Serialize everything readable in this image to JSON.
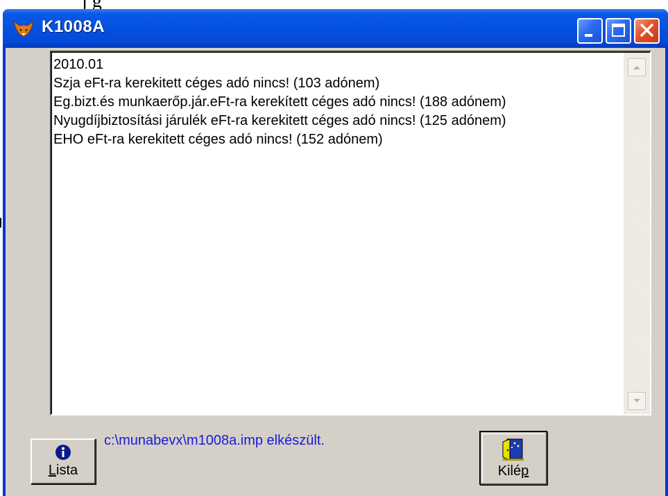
{
  "background": {
    "partial_text": "j g"
  },
  "window": {
    "title": "K1008A",
    "controls": {
      "minimize": "minimize-icon",
      "maximize": "maximize-icon",
      "close": "close-icon"
    }
  },
  "list": {
    "lines": [
      "2010.01",
      "Szja eFt-ra kerekitett céges adó nincs! (103 adónem)",
      "Eg.bizt.és munkaerőp.jár.eFt-ra kerekített céges adó nincs! (188 adónem)",
      "Nyugdíjbiztosítási járulék eFt-ra kerekitett céges adó nincs! (125 adónem)",
      "EHO eFt-ra kerekitett céges adó nincs! (152 adónem)"
    ]
  },
  "status": {
    "text": "c:\\munabevx\\m1008a.imp elkészült."
  },
  "buttons": {
    "lista": {
      "underlined": "L",
      "rest": "ista",
      "icon": "info-icon"
    },
    "kilep": {
      "before": "Kilé",
      "underlined": "p",
      "icon": "exit-door-icon"
    }
  },
  "colors": {
    "titlebar": "#0651e0",
    "client_bg": "#d4d0c8",
    "status_text": "#1a1ad8",
    "close_button": "#e0522d"
  }
}
